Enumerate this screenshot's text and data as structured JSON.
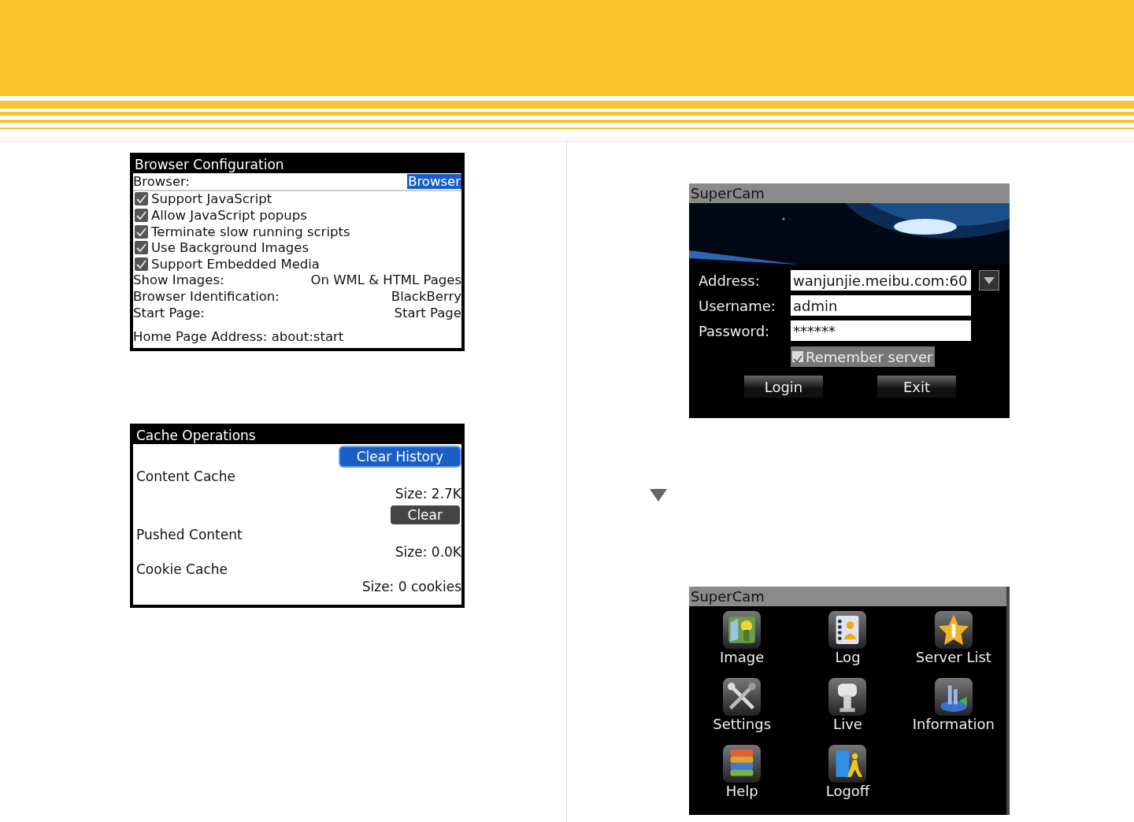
{
  "browser_config": {
    "title": "Browser Configuration",
    "rows": [
      {
        "kind": "select",
        "label": "Browser:",
        "value": "Browser",
        "focused": true
      },
      {
        "kind": "checkbox",
        "label": "Support JavaScript",
        "checked": true
      },
      {
        "kind": "checkbox",
        "label": "Allow JavaScript popups",
        "checked": true
      },
      {
        "kind": "checkbox",
        "label": "Terminate slow running scripts",
        "checked": true
      },
      {
        "kind": "checkbox",
        "label": "Use Background Images",
        "checked": true
      },
      {
        "kind": "checkbox",
        "label": "Support Embedded Media",
        "checked": true
      },
      {
        "kind": "setting",
        "label": "Show Images:",
        "value": "On WML & HTML Pages"
      },
      {
        "kind": "setting",
        "label": "Browser Identification:",
        "value": "BlackBerry"
      },
      {
        "kind": "setting",
        "label": "Start Page:",
        "value": "Start Page"
      },
      {
        "kind": "text",
        "label": "Home Page Address: about:start"
      }
    ]
  },
  "cache_operations": {
    "title": "Cache Operations",
    "rows": [
      {
        "kind": "button",
        "label": "Clear History",
        "focused": true
      },
      {
        "kind": "label",
        "label": "Content Cache"
      },
      {
        "kind": "size",
        "label": "Size: 2.7K"
      },
      {
        "kind": "button",
        "label": "Clear",
        "focused": false
      },
      {
        "kind": "label",
        "label": "Pushed Content"
      },
      {
        "kind": "size",
        "label": "Size: 0.0K"
      },
      {
        "kind": "label",
        "label": "Cookie Cache"
      },
      {
        "kind": "size",
        "label": "Size: 0 cookies"
      }
    ]
  },
  "login_screen": {
    "title": "SuperCam",
    "banner": {
      "kind": "picture"
    },
    "fields": [
      {
        "label": "Address:",
        "value": "wanjunjie.meibu.com:60",
        "dropdown": true
      },
      {
        "label": "Username:",
        "value": "admin",
        "dropdown": false
      },
      {
        "label": "Password:",
        "value": "******",
        "dropdown": false
      }
    ],
    "remember": {
      "label": "Remember server",
      "checked": true
    },
    "buttons": [
      "Login",
      "Exit"
    ]
  },
  "menu_screen": {
    "title": "SuperCam",
    "items": [
      {
        "label": "Image"
      },
      {
        "label": "Log"
      },
      {
        "label": "Server List"
      },
      {
        "label": "Settings"
      },
      {
        "label": "Live"
      },
      {
        "label": "Information"
      },
      {
        "label": "Help"
      },
      {
        "label": "Logoff"
      }
    ]
  }
}
